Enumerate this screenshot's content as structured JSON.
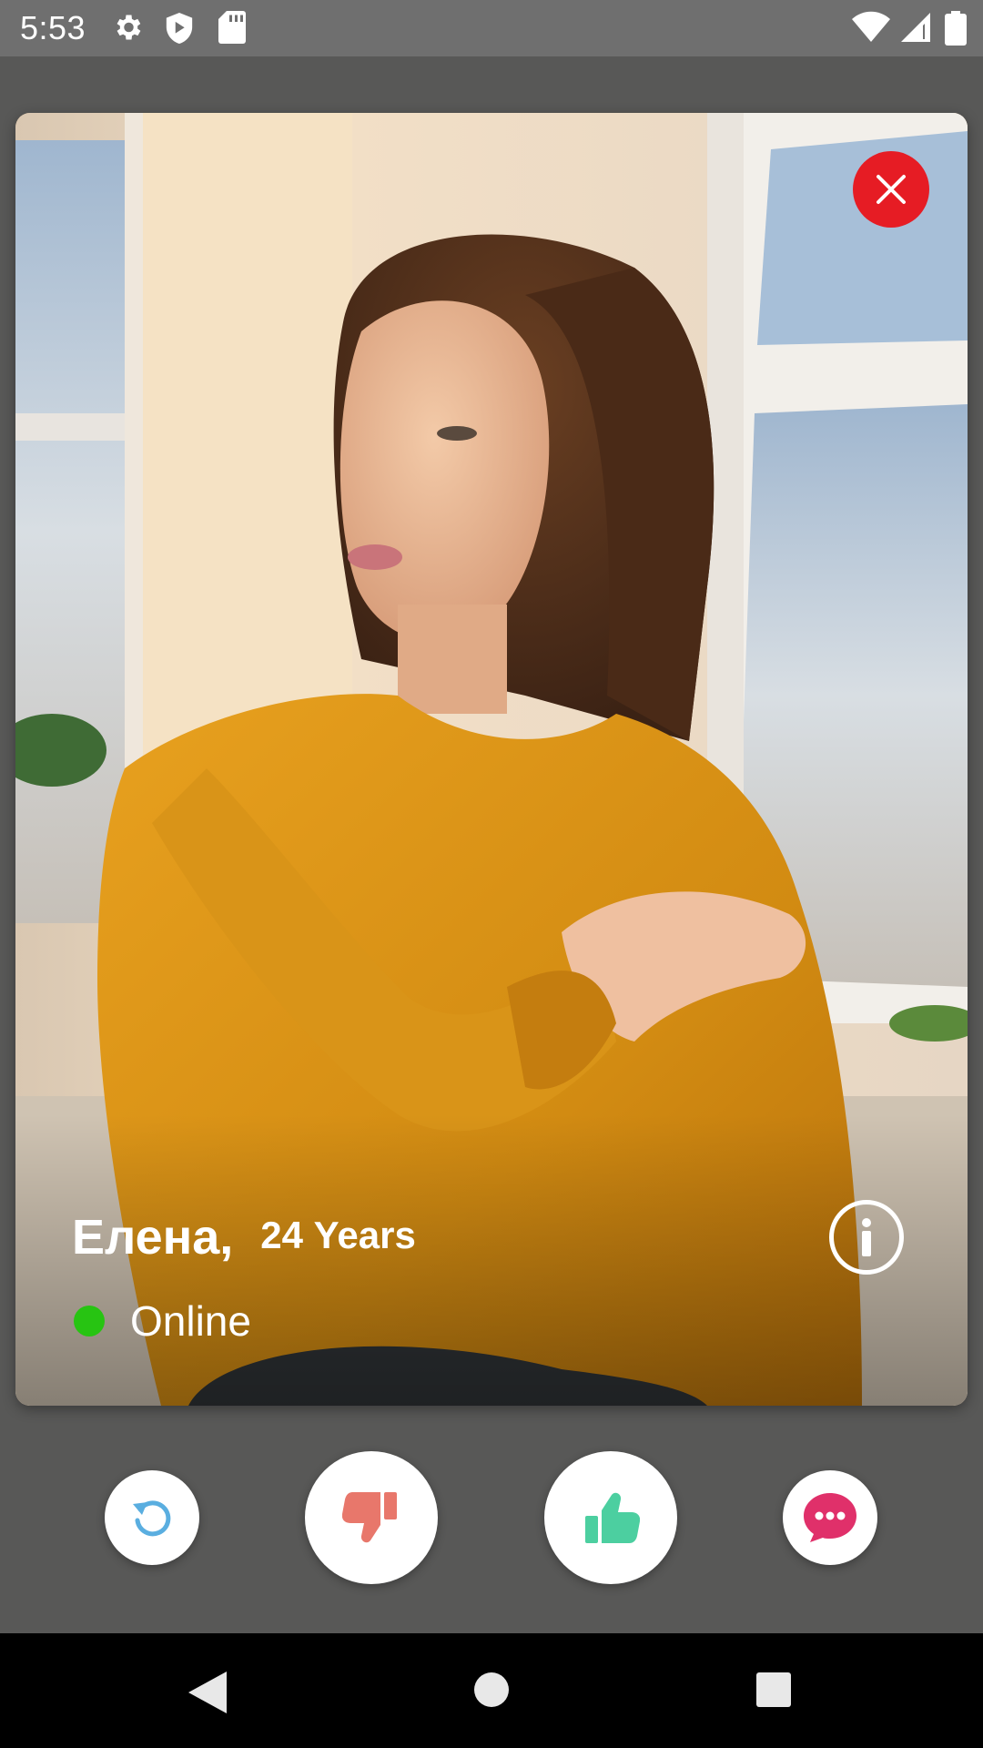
{
  "status_bar": {
    "time": "5:53",
    "left_icons": [
      "settings-icon",
      "shield-icon",
      "sd-card-icon"
    ],
    "right_icons": [
      "wifi-icon",
      "cell-signal-icon",
      "battery-icon"
    ]
  },
  "profile_card": {
    "photo": "woman-in-yellow-sweater-photo",
    "name": "Елена,",
    "age": "24 Years",
    "status": "Online",
    "status_color": "#27c412",
    "close_color": "#e61c24"
  },
  "actions": {
    "rewind": {
      "icon": "rewind-icon",
      "color": "#5aaee0"
    },
    "dislike": {
      "icon": "thumbs-down-icon",
      "color": "#e8776b"
    },
    "like": {
      "icon": "thumbs-up-icon",
      "color": "#4ccfa0"
    },
    "chat": {
      "icon": "chat-bubble-icon",
      "color": "#e0306a"
    }
  },
  "nav": [
    "back-icon",
    "home-icon",
    "recents-icon"
  ]
}
